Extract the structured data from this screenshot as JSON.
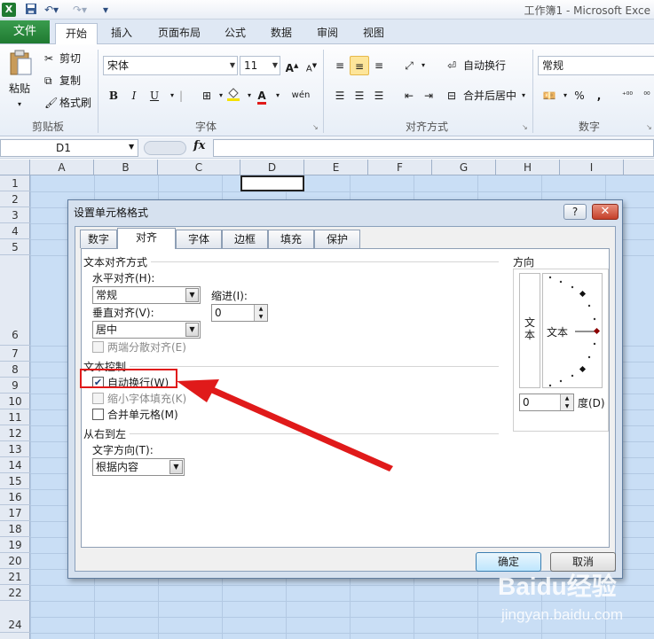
{
  "window": {
    "title": "工作簿1 - Microsoft Exce",
    "excel_logo": "X"
  },
  "ribbon_tabs": [
    "文件",
    "开始",
    "插入",
    "页面布局",
    "公式",
    "数据",
    "审阅",
    "视图"
  ],
  "clipboard": {
    "paste": "粘贴",
    "cut": "剪切",
    "copy": "复制",
    "format_painter": "格式刷",
    "group": "剪贴板"
  },
  "font": {
    "name": "宋体",
    "size": "11",
    "bold": "B",
    "italic": "I",
    "underline": "U",
    "group": "字体",
    "grow": "A",
    "shrink": "A",
    "color_letter": "A",
    "phonetic": "wén"
  },
  "alignment": {
    "wrap_text": "自动换行",
    "merge_center": "合并后居中",
    "group": "对齐方式"
  },
  "number": {
    "format": "常规",
    "percent": "%",
    "comma": ",",
    "group": "数字"
  },
  "formula_bar": {
    "name_box": "D1",
    "fx": "fx"
  },
  "columns": [
    "A",
    "B",
    "C",
    "D",
    "E",
    "F",
    "G",
    "H",
    "I"
  ],
  "rows": [
    "1",
    "2",
    "3",
    "4",
    "5",
    "6",
    "7",
    "8",
    "9",
    "10",
    "11",
    "12",
    "13",
    "14",
    "15",
    "16",
    "17",
    "18",
    "19",
    "20",
    "21",
    "22",
    "24"
  ],
  "dialog": {
    "title": "设置单元格格式",
    "help": "?",
    "close": "✕",
    "tabs": [
      "数字",
      "对齐",
      "字体",
      "边框",
      "填充",
      "保护"
    ],
    "active_tab": "对齐",
    "text_alignment_section": "文本对齐方式",
    "horizontal_label": "水平对齐(H):",
    "horizontal_value": "常规",
    "indent_label": "缩进(I):",
    "indent_value": "0",
    "vertical_label": "垂直对齐(V):",
    "vertical_value": "居中",
    "justify_distributed": "两端分散对齐(E)",
    "text_control_section": "文本控制",
    "wrap_text": "自动换行(W)",
    "wrap_text_checked": true,
    "shrink_to_fit": "缩小字体填充(K)",
    "merge_cells": "合并单元格(M)",
    "rtl_section": "从右到左",
    "text_direction_label": "文字方向(T):",
    "text_direction_value": "根据内容",
    "orientation_section": "方向",
    "orientation_vertical_text": "文本",
    "orientation_text": "文本",
    "degree_value": "0",
    "degree_label": "度(D)",
    "ok": "确定",
    "cancel": "取消"
  },
  "watermark": {
    "logo": "Baidu经验",
    "url": "jingyan.baidu.com"
  },
  "colors": {
    "selection_fill": "#c9def5",
    "highlight_red": "#e01a1a",
    "excel_green": "#1f7a31"
  }
}
